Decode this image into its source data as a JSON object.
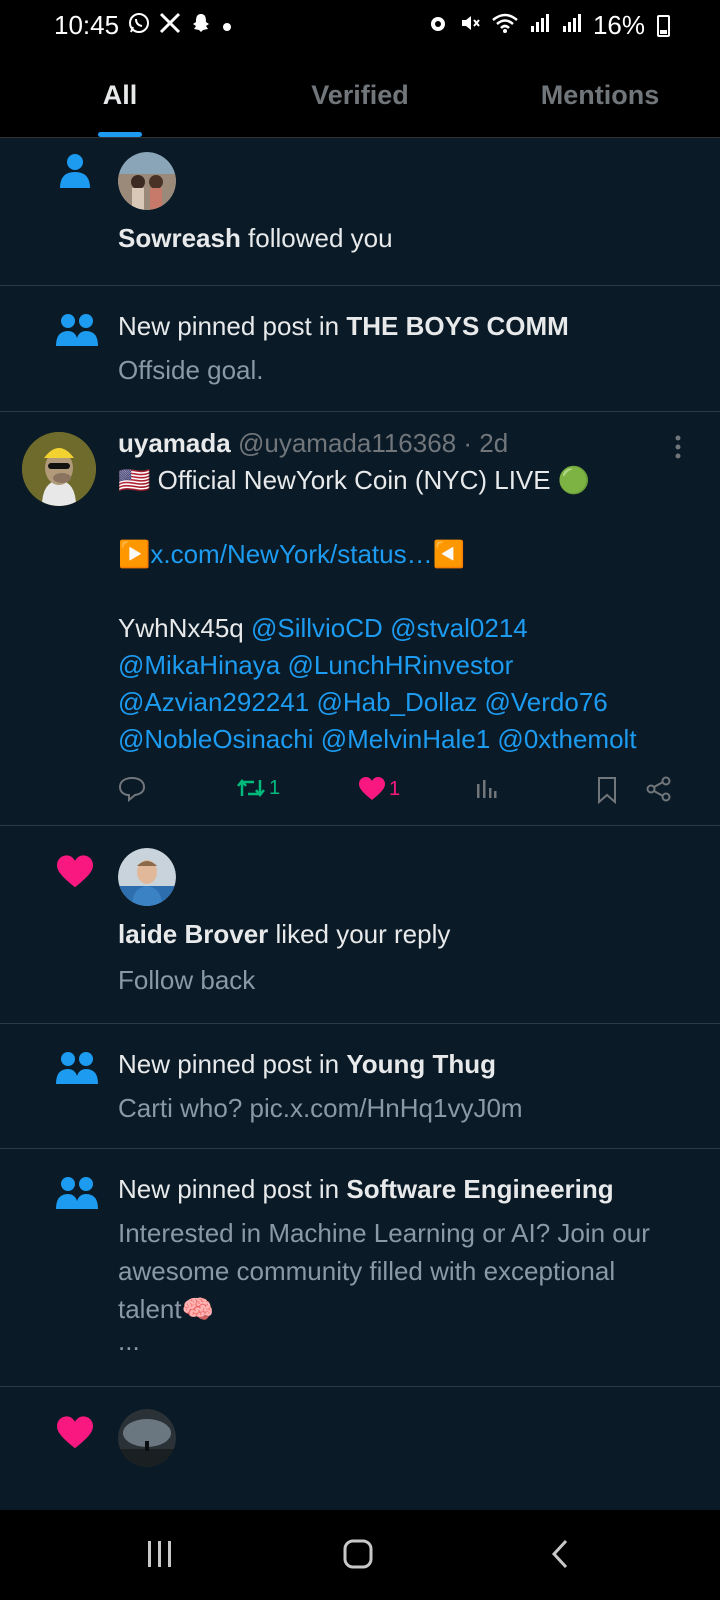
{
  "status_bar": {
    "time": "10:45",
    "left_icons": [
      "whatsapp-icon",
      "x-icon",
      "snapchat-icon",
      "dot-icon"
    ],
    "right_icons": [
      "alarm-icon",
      "mute-icon",
      "wifi-icon",
      "signal-icon",
      "signal-icon"
    ],
    "battery": "16%"
  },
  "tabs": [
    {
      "label": "All",
      "active": true
    },
    {
      "label": "Verified",
      "active": false
    },
    {
      "label": "Mentions",
      "active": false
    }
  ],
  "notifications": [
    {
      "type": "follow",
      "icon": "person-icon",
      "name": "Sowreash",
      "text": " followed you"
    },
    {
      "type": "pinned",
      "icon": "community-icon",
      "prefix": "New pinned post in ",
      "community": "THE BOYS COMM",
      "snippet": "Offside goal."
    },
    {
      "type": "post",
      "author": "uyamada",
      "handle": "@uyamada116368",
      "time": "· 2d",
      "line1": "🇺🇸 Official NewYork Coin (NYC) LIVE 🟢",
      "link_prefix": "▶️",
      "link": "x.com/NewYork/status…",
      "link_suffix": "◀️",
      "code": "YwhNx45q",
      "mentions": [
        "@SillvioCD",
        "@stval0214",
        "@MikaHinaya",
        "@LunchHRinvestor",
        "@Azvian292241",
        "@Hab_Dollaz",
        "@Verdo76",
        "@NobleOsinachi",
        "@MelvinHale1",
        "@0xthemolt"
      ],
      "retweets": "1",
      "likes": "1"
    },
    {
      "type": "like",
      "icon": "heart-icon",
      "name": "laide Brover",
      "text": " liked your reply",
      "snippet": "Follow back"
    },
    {
      "type": "pinned",
      "icon": "community-icon",
      "prefix": "New pinned post in ",
      "community": "Young Thug",
      "snippet": "Carti who? pic.x.com/HnHq1vyJ0m"
    },
    {
      "type": "pinned",
      "icon": "community-icon",
      "prefix": "New pinned post in ",
      "community": "Software Engineering",
      "snippet_lines": [
        "Interested in Machine Learning or AI? Join our",
        "awesome community filled with exceptional",
        "talent🧠",
        "..."
      ]
    },
    {
      "type": "like",
      "icon": "heart-icon"
    }
  ],
  "colors": {
    "accent": "#1d9bf0",
    "like": "#f91880",
    "retweet": "#00ba7c",
    "background": "#0a1a26"
  }
}
